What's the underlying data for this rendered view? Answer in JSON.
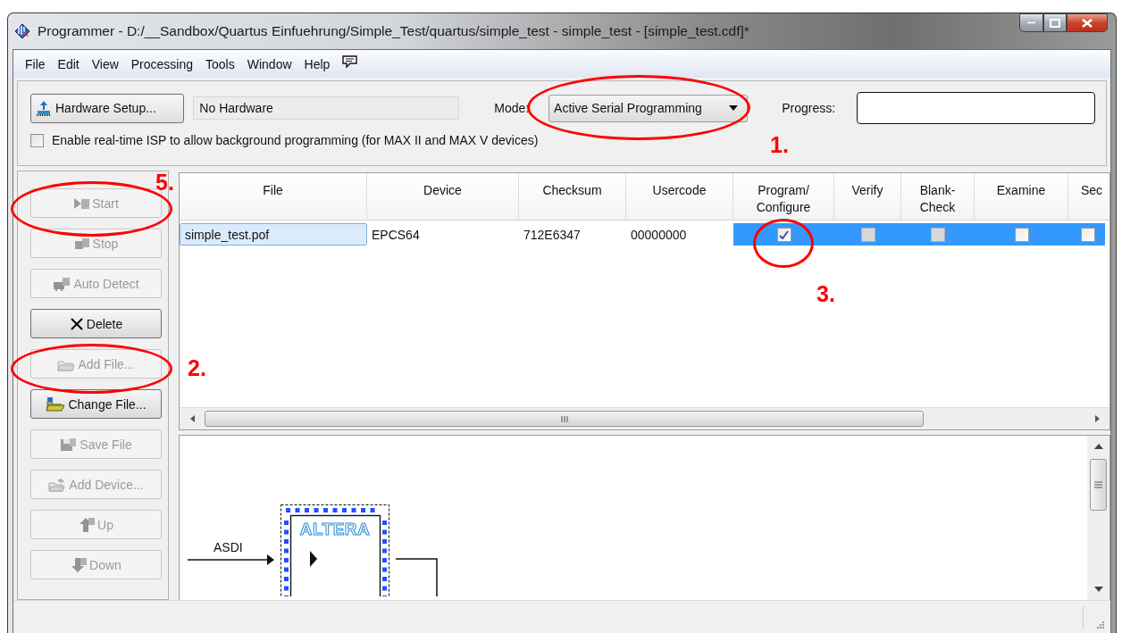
{
  "window": {
    "title": "Programmer - D:/__Sandbox/Quartus Einfuehrung/Simple_Test/quartus/simple_test - simple_test - [simple_test.cdf]*"
  },
  "menu": [
    "File",
    "Edit",
    "View",
    "Processing",
    "Tools",
    "Window",
    "Help"
  ],
  "toolbar": {
    "hardware_button": "Hardware Setup...",
    "hardware_field": "No Hardware",
    "mode_label": "Mode:",
    "mode": {
      "value": "Active Serial Programming"
    },
    "progress_label": "Progress:",
    "progress": {
      "level": 0
    },
    "isp_checkbox": {
      "label": "Enable real-time ISP to allow background programming (for MAX II and MAX V devices)",
      "checked": false
    }
  },
  "sidebar": {
    "buttons": [
      {
        "label": "Start",
        "kind": "start",
        "disabled": true
      },
      {
        "label": "Stop",
        "kind": "stop",
        "disabled": true
      },
      {
        "label": "Auto Detect",
        "kind": "auto_detect",
        "disabled": true
      },
      {
        "label": "Delete",
        "kind": "delete",
        "disabled": false
      },
      {
        "label": "Add File...",
        "kind": "add_file",
        "disabled": true
      },
      {
        "label": "Change File...",
        "kind": "change_file",
        "disabled": false
      },
      {
        "label": "Save File",
        "kind": "save_file",
        "disabled": true
      },
      {
        "label": "Add Device...",
        "kind": "add_device",
        "disabled": true
      },
      {
        "label": "Up",
        "kind": "up",
        "disabled": true
      },
      {
        "label": "Down",
        "kind": "down",
        "disabled": true
      }
    ]
  },
  "table": {
    "columns": [
      "File",
      "Device",
      "Checksum",
      "Usercode",
      "Program/\nConfigure",
      "Verify",
      "Blank-\nCheck",
      "Examine",
      "Sec"
    ],
    "rows": [
      {
        "selected": true,
        "cells": [
          "simple_test.pof",
          "EPCS64",
          "712E6347",
          "00000000"
        ],
        "checks": [
          {
            "checked": true,
            "disabled": false
          },
          {
            "checked": false,
            "disabled": true
          },
          {
            "checked": false,
            "disabled": true
          },
          {
            "checked": false,
            "disabled": false
          },
          {
            "checked": false,
            "disabled": false
          }
        ]
      }
    ]
  },
  "diagram": {
    "input_label": "ASDI",
    "logo": "ALTERA"
  },
  "annotations": [
    {
      "label": "1."
    },
    {
      "label": "2."
    },
    {
      "label": "3."
    },
    {
      "label": "5."
    }
  ]
}
